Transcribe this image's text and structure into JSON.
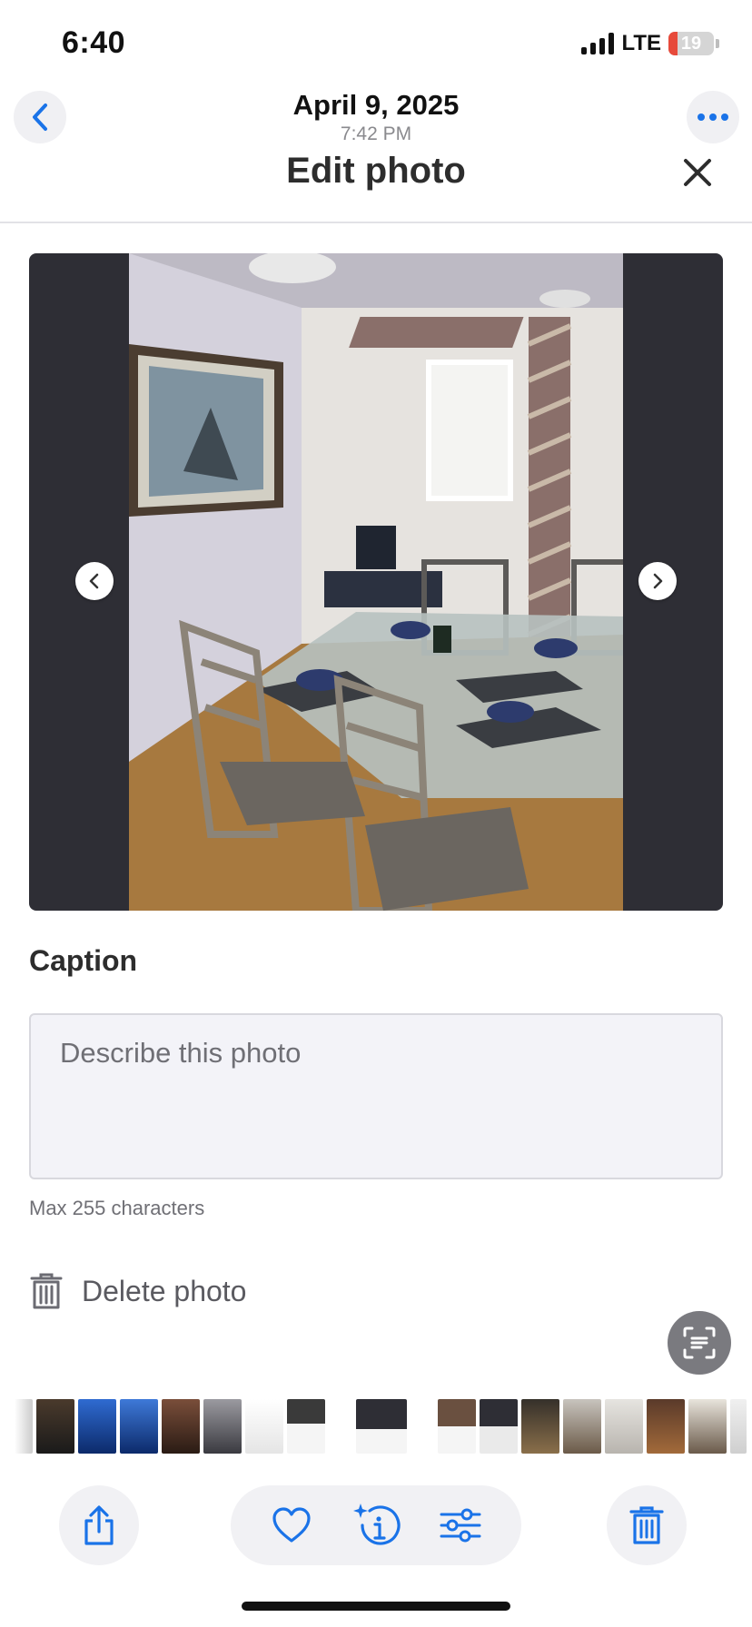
{
  "status_bar": {
    "time": "6:40",
    "network": "LTE",
    "battery_level": "19",
    "battery_fraction": 0.19,
    "battery_color": "#e74a3b"
  },
  "viewer_header": {
    "date": "April 9, 2025",
    "time": "7:42 PM",
    "back_icon": "chevron-left-icon",
    "more_icon": "ellipsis-icon",
    "accent_color": "#1a73e8"
  },
  "edit_sheet": {
    "title": "Edit photo",
    "close_icon": "close-icon",
    "photo_description": "dining-room-photo",
    "prev_icon": "chevron-left-icon",
    "next_icon": "chevron-right-icon",
    "caption": {
      "label": "Caption",
      "placeholder": "Describe this photo",
      "value": "",
      "hint": "Max 255 characters"
    },
    "delete_label": "Delete photo"
  },
  "live_text_icon": "live-text-icon",
  "thumbnails": {
    "count_left": 7,
    "count_right": 8
  },
  "toolbar": {
    "share_icon": "share-icon",
    "favorite_icon": "heart-icon",
    "info_icon": "info-sparkle-icon",
    "adjust_icon": "sliders-icon",
    "delete_icon": "trash-icon"
  }
}
